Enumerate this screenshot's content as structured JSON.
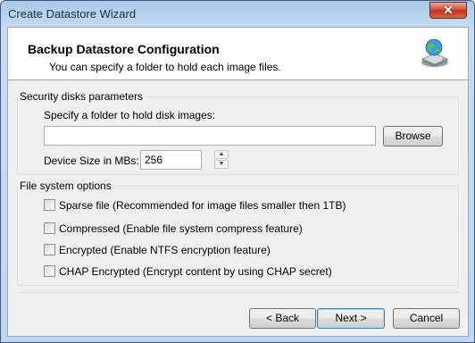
{
  "window": {
    "title": "Create Datastore Wizard",
    "close_label": "✕"
  },
  "header": {
    "title": "Backup Datastore Configuration",
    "subtitle": "You can specify a folder to hold each image files.",
    "icon": "network-drive-globe-icon"
  },
  "security": {
    "group_label": "Security disks parameters",
    "folder_prompt": "Specify a folder to hold disk images:",
    "folder_value": "",
    "browse_label": "Browse",
    "size_label": "Device Size in MBs:",
    "size_value": "256"
  },
  "filesystem": {
    "group_label": "File system options",
    "options": [
      {
        "label": "Sparse file (Recommended for image files smaller then 1TB)",
        "checked": false
      },
      {
        "label": "Compressed (Enable file system compress feature)",
        "checked": false
      },
      {
        "label": "Encrypted (Enable NTFS encryption feature)",
        "checked": false
      },
      {
        "label": "CHAP Encrypted (Encrypt content by using CHAP secret)",
        "checked": false
      }
    ]
  },
  "footer": {
    "back_label": "< Back",
    "next_label": "Next >",
    "cancel_label": "Cancel"
  }
}
